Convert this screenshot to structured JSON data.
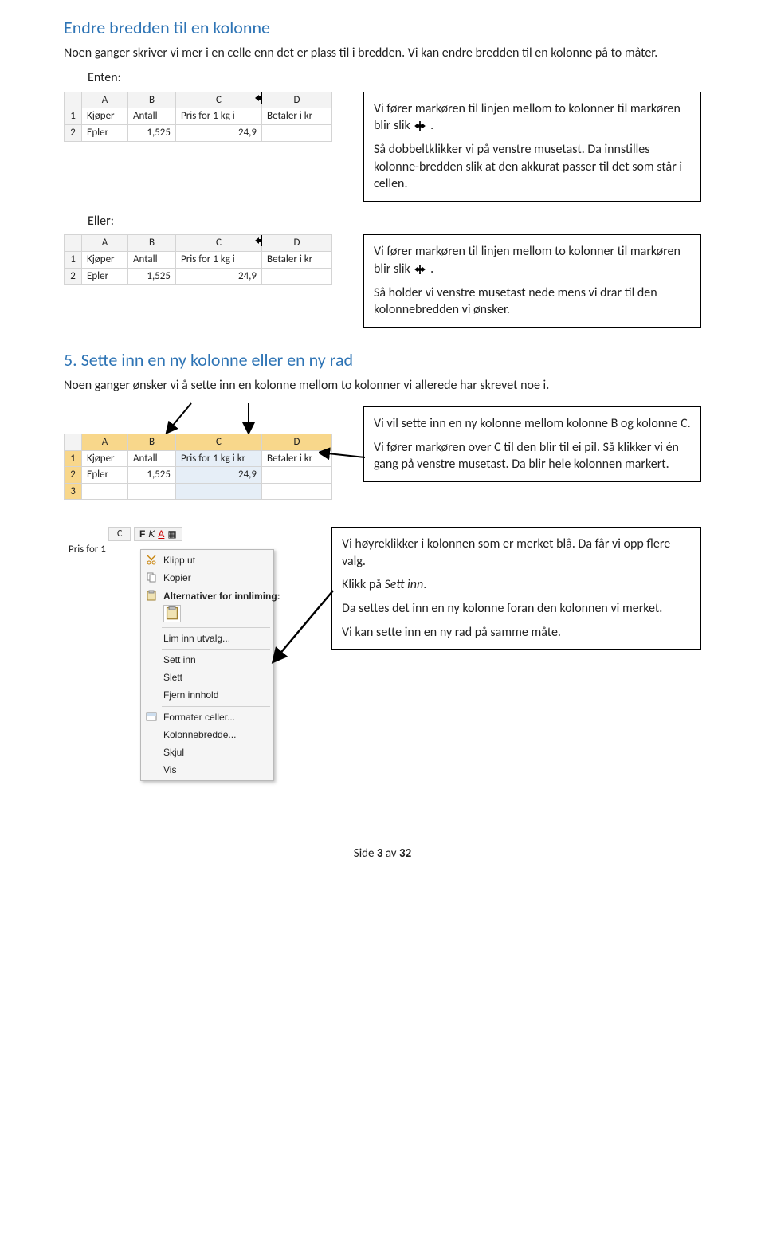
{
  "heading1": "Endre bredden til en kolonne",
  "para1": "Noen ganger skriver vi mer i en celle enn det er plass til i bredden. Vi kan endre bredden til en kolonne på to måter.",
  "enten": "Enten:",
  "eller": "Eller:",
  "sheet_hdr": {
    "A": "A",
    "B": "B",
    "C": "C",
    "D": "D"
  },
  "row1": {
    "hdr": "1",
    "A": "Kjøper",
    "B": "Antall",
    "C": "Pris for 1 kg i",
    "D": "Betaler i kr"
  },
  "row2": {
    "hdr": "2",
    "A": "Epler",
    "B": "1,525",
    "C": "24,9",
    "D": ""
  },
  "callout1": {
    "l1a": "Vi fører markøren til linjen mellom to kolonner til markøren blir slik",
    "l1b": ".",
    "l2": "Så dobbeltklikker vi på venstre musetast. Da innstilles kolonne-bredden slik at den akkurat passer til det som står i cellen."
  },
  "callout2": {
    "l1a": "Vi fører markøren til linjen mellom to kolonner til markøren blir slik",
    "l1b": ".",
    "l2": "Så holder vi venstre musetast nede mens vi drar til den kolonnebredden vi ønsker."
  },
  "heading2_num": "5.",
  "heading2_txt": "Sette inn en ny kolonne eller en ny rad",
  "para2": "Noen ganger ønsker vi å sette inn en kolonne mellom to kolonner vi allerede har skrevet noe i.",
  "sheet3_row1": {
    "hdr": "1",
    "A": "Kjøper",
    "B": "Antall",
    "C": "Pris for 1 kg i kr",
    "D": "Betaler i kr"
  },
  "sheet3_row2": {
    "hdr": "2",
    "A": "Epler",
    "B": "1,525",
    "C": "24,9",
    "D": ""
  },
  "sheet3_row3": {
    "hdr": "3"
  },
  "callout3": {
    "l1": "Vi vil sette inn en ny kolonne mellom kolonne B og kolonne C.",
    "l2": "Vi fører markøren over C til den blir til ei pil. Så klikker vi én gang på venstre musetast. Da blir hele kolonnen markert."
  },
  "callout4": {
    "l1": "Vi høyreklikker i kolonnen som er merket blå. Da får vi opp flere valg.",
    "l2a": "Klikk på ",
    "l2b": "Sett inn",
    "l2c": ".",
    "l3": "Da settes det inn en ny kolonne foran den kolonnen vi merket.",
    "l4": "Vi kan sette inn en ny rad på samme måte."
  },
  "ctx": {
    "topcell": "Pris for 1",
    "fmt": {
      "C": "C",
      "F": "F",
      "K": "K"
    },
    "items": {
      "klipp_ut": "Klipp ut",
      "kopier": "Kopier",
      "alt_label": "Alternativer for innliming:",
      "lim_inn_utvalg": "Lim inn utvalg...",
      "sett_inn": "Sett inn",
      "slett": "Slett",
      "fjern_innhold": "Fjern innhold",
      "formater_celler": "Formater celler...",
      "kolonnebredde": "Kolonnebredde...",
      "skjul": "Skjul",
      "vis": "Vis"
    },
    "ul": {
      "klipp_ut": "K",
      "kopier": "K",
      "lim": "v",
      "sett": "e",
      "slett": "l",
      "fjern": "i",
      "formater": "F",
      "kolbr": "b",
      "skjul": "k",
      "vis": "V"
    }
  },
  "footer": {
    "a": "Side ",
    "b": "3",
    "c": " av ",
    "d": "32"
  }
}
